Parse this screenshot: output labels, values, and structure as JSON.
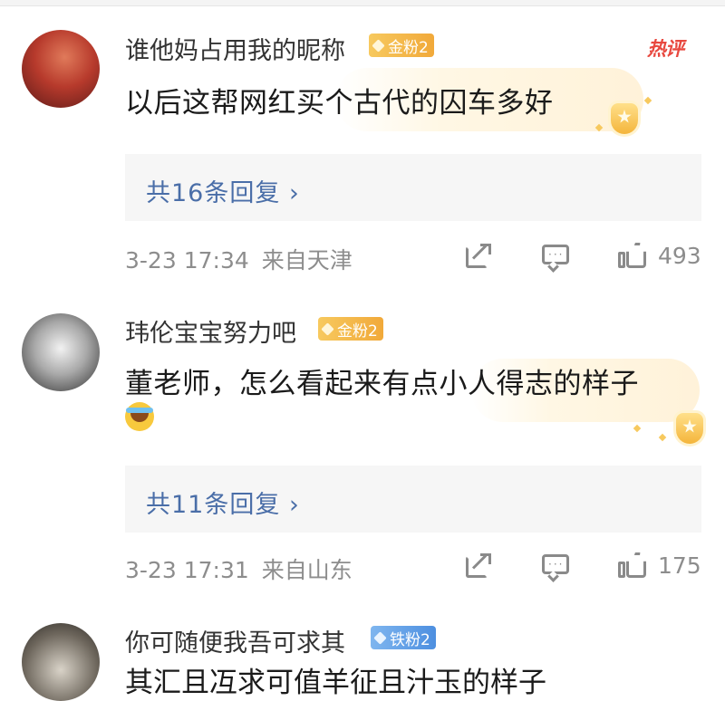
{
  "hot_label": "热评",
  "comments": [
    {
      "username": "谁他妈占用我的昵称",
      "badge": "金粉2",
      "text": "以后这帮网红买个古代的囚车多好",
      "replies": "共16条回复 ›",
      "date": "3-23",
      "time": "17:34",
      "location": "来自天津",
      "likes": "493"
    },
    {
      "username": "玮伦宝宝努力吧",
      "badge": "金粉2",
      "text": "董老师，怎么看起来有点小人得志的样子",
      "replies": "共11条回复 ›",
      "date": "3-23",
      "time": "17:31",
      "location": "来自山东",
      "likes": "175"
    },
    {
      "username": "你可随便我吾可求其",
      "badge": "铁粉2",
      "text": "其汇且冱求可值羊征且汁玉的样子"
    }
  ],
  "colors": {
    "gold_badge": "#f1a93a",
    "iron_badge": "#4d8fe0",
    "link": "#4a6ea8",
    "hot": "#e8483f"
  }
}
